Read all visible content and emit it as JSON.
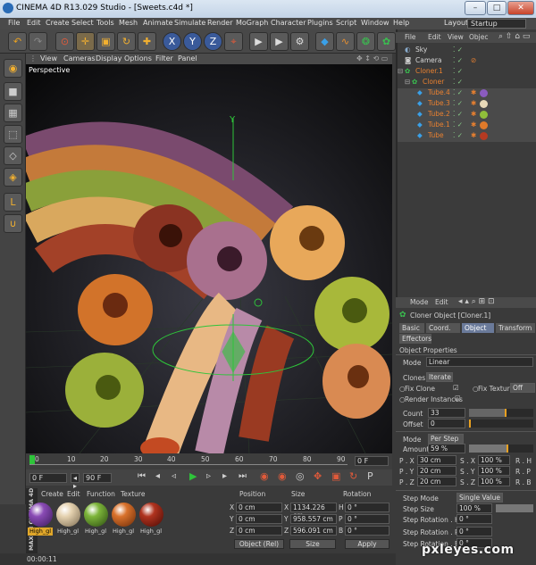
{
  "window": {
    "title": "CINEMA 4D R13.029 Studio - [Sweets.c4d *]",
    "min": "–",
    "max": "□",
    "close": "✕"
  },
  "menu": [
    "File",
    "Edit",
    "Create",
    "Select",
    "Tools",
    "Mesh",
    "Animate",
    "Simulate",
    "Render",
    "MoGraph",
    "Character",
    "Plugins",
    "Script",
    "Window",
    "Help"
  ],
  "layout": {
    "label": "Layout:",
    "value": "Startup"
  },
  "viewport": {
    "menu": [
      "View",
      "Cameras",
      "Display",
      "Options",
      "Filter",
      "Panel"
    ],
    "label": "Perspective",
    "axis_y": "Y"
  },
  "object_manager": {
    "menu": [
      "File",
      "Edit",
      "View",
      "Objec"
    ],
    "objects": [
      {
        "name": "Sky",
        "indent": 0
      },
      {
        "name": "Camera",
        "indent": 0
      },
      {
        "name": "Cloner.1",
        "indent": 0
      },
      {
        "name": "Cloner",
        "indent": 1
      },
      {
        "name": "Tube.4",
        "indent": 2
      },
      {
        "name": "Tube.3",
        "indent": 2
      },
      {
        "name": "Tube.2",
        "indent": 2
      },
      {
        "name": "Tube.1",
        "indent": 2
      },
      {
        "name": "Tube",
        "indent": 2
      }
    ],
    "tag_colors": [
      "#8a5bbf",
      "#e8d9b8",
      "#8fbf3a",
      "#e07a2a",
      "#b53a22"
    ]
  },
  "attributes": {
    "menu": [
      "Mode",
      "Edit"
    ],
    "title": "Cloner Object [Cloner.1]",
    "tabs": [
      "Basic",
      "Coord.",
      "Object",
      "Transform",
      "Effectors"
    ],
    "section": "Object Properties",
    "mode_label": "Mode",
    "mode_value": "Linear",
    "clones_label": "Clones",
    "clones_value": "Iterate",
    "fix_clone": "Fix Clone",
    "fix_texture": "Fix Texture",
    "fix_texture_value": "Off",
    "render_instances": "Render Instances",
    "count_label": "Count",
    "count_value": "33",
    "offset_label": "Offset",
    "offset_value": "0",
    "mode2_label": "Mode",
    "mode2_value": "Per Step",
    "amount_label": "Amount",
    "amount_value": "59 %",
    "p_x_label": "P . X",
    "p_x": "30 cm",
    "p_y_label": "P . Y",
    "p_y": "20 cm",
    "p_z_label": "P . Z",
    "p_z": "20 cm",
    "s_x_label": "S . X",
    "s_x": "100 %",
    "s_y_label": "S . Y",
    "s_y": "100 %",
    "s_z_label": "S . Z",
    "s_z": "100 %",
    "r_h": "R . H",
    "r_p": "R . P",
    "r_b": "R . B",
    "step_mode_label": "Step Mode",
    "step_mode_value": "Single Value",
    "step_size_label": "Step Size",
    "step_size_value": "100 %",
    "step_rot_h_label": "Step Rotation . H",
    "step_rot_h": "0 °",
    "step_rot_p_label": "Step Rotation . P",
    "step_rot_p": "0 °",
    "step_rot_b_label": "Step Rotation . B",
    "step_rot_b": "0 °"
  },
  "timeline": {
    "ticks": [
      "0",
      "10",
      "20",
      "30",
      "40",
      "50",
      "60",
      "70",
      "80",
      "90"
    ],
    "frame": "0 F",
    "start": "0 F",
    "end": "90 F",
    "preview": "90 F",
    "speed": "◂ ▸"
  },
  "materials": {
    "menu": [
      "Create",
      "Edit",
      "Function",
      "Texture"
    ],
    "items": [
      {
        "label": "High_gl",
        "color": "#8a4bb5",
        "selected": true
      },
      {
        "label": "High_gl",
        "color": "#e5d2b0",
        "selected": false
      },
      {
        "label": "High_gl",
        "color": "#7db53a",
        "selected": false
      },
      {
        "label": "High_gl",
        "color": "#d9722c",
        "selected": false
      },
      {
        "label": "High_gl",
        "color": "#b0331f",
        "selected": false
      }
    ],
    "brand": "MAXON CINEMA 4D"
  },
  "coordinates": {
    "headers": [
      "Position",
      "Size",
      "Rotation"
    ],
    "rows": [
      {
        "axis": "X",
        "pos": "0 cm",
        "size": "1134.226 cm",
        "rot_axis": "H",
        "rot": "0 °"
      },
      {
        "axis": "Y",
        "pos": "0 cm",
        "size": "958.557 cm",
        "rot_axis": "P",
        "rot": "0 °"
      },
      {
        "axis": "Z",
        "pos": "0 cm",
        "size": "596.091 cm",
        "rot_axis": "B",
        "rot": "0 °"
      }
    ],
    "mode": "Object (Rel)",
    "size_mode": "Size",
    "apply": "Apply"
  },
  "status": {
    "time": "00:00:11"
  },
  "watermark": "pxleyes.com"
}
